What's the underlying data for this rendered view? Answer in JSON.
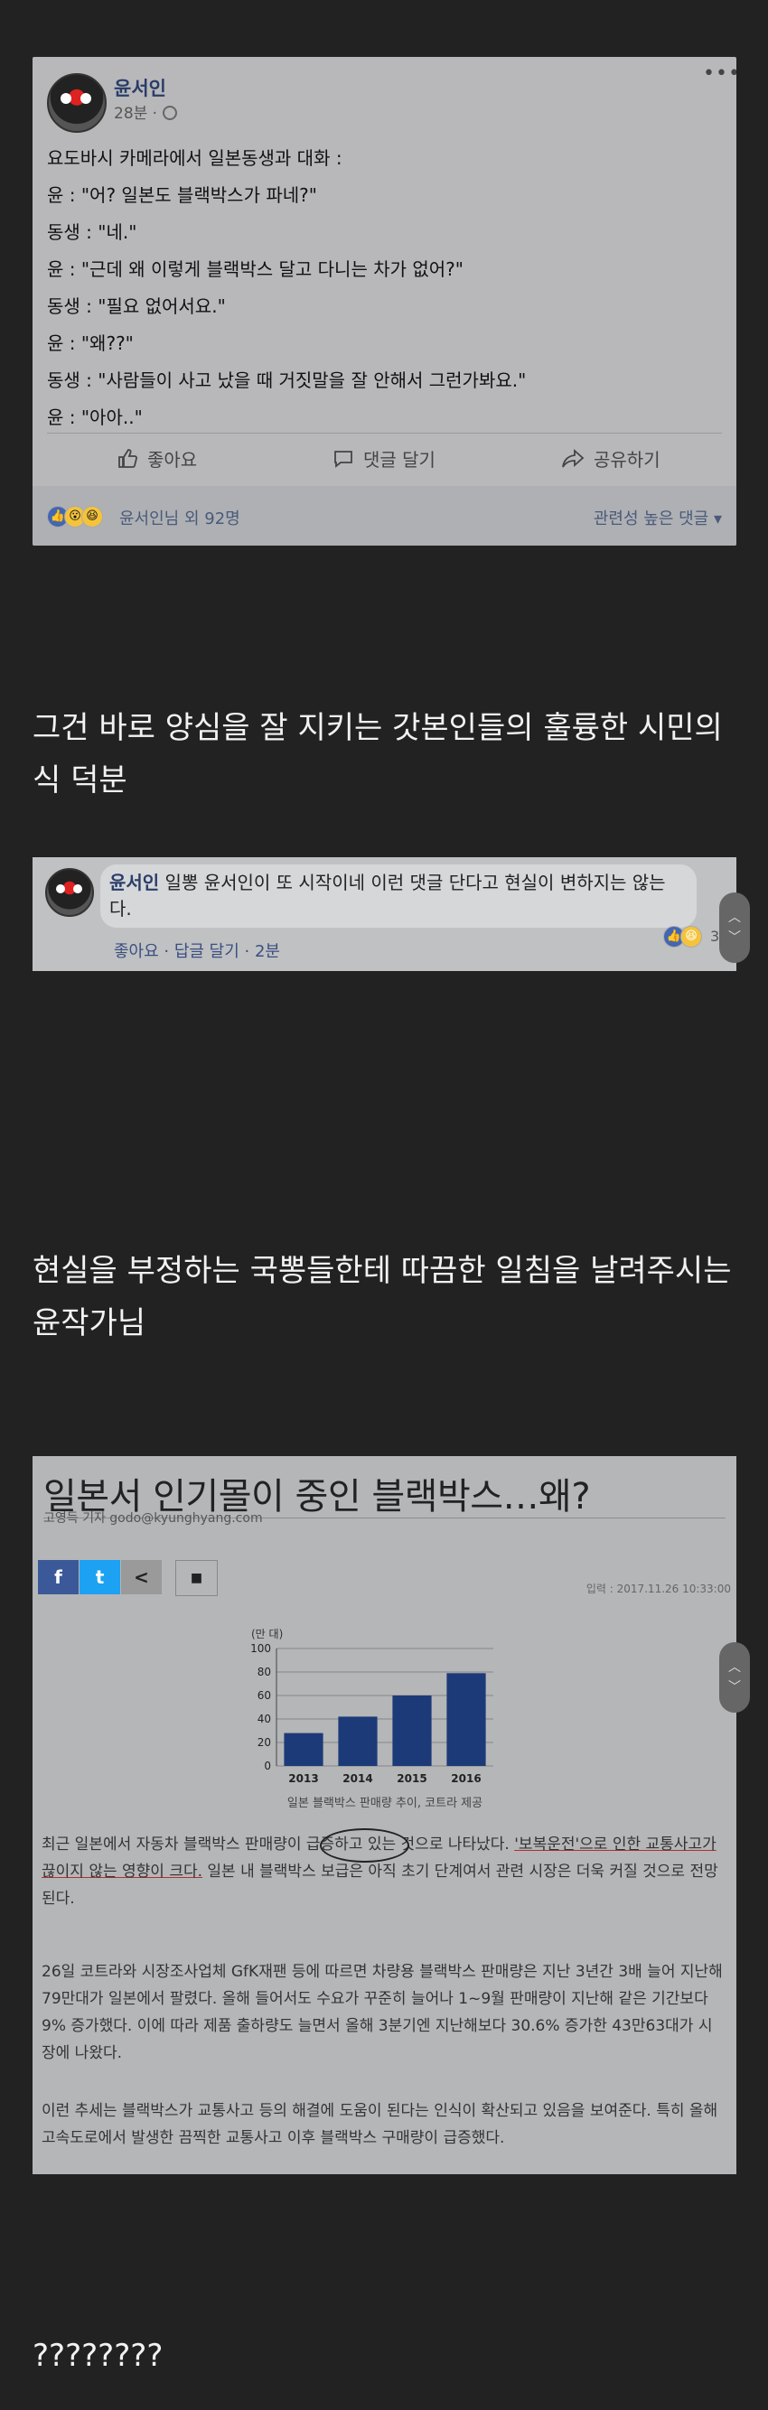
{
  "post": {
    "author": "윤서인",
    "time": "28분 ·",
    "globe_icon": "globe-icon",
    "lines": [
      "요도바시 카메라에서 일본동생과 대화 :",
      "윤 : \"어? 일본도 블랙박스가 파네?\"",
      "동생 : \"네.\"",
      "윤 : \"근데 왜 이렇게 블랙박스 달고 다니는 차가 없어?\"",
      "동생 : \"필요 없어서요.\"",
      "윤 : \"왜??\"",
      "동생 : \"사람들이 사고 났을 때 거짓말을 잘 안해서 그런가봐요.\"",
      "윤 : \"아아..\""
    ],
    "actions": {
      "like": "좋아요",
      "comment": "댓글 달기",
      "share": "공유하기"
    },
    "reactions_text": "윤서인님 외 92명",
    "sort_label": "관련성 높은 댓글 ▾"
  },
  "caption1": "그건 바로 양심을 잘 지키는 갓본인들의 훌륭한 시민의식 덕분",
  "comment": {
    "author": "윤서인",
    "text": " 일뽕 윤서인이 또 시작이네 이런 댓글 단다고 현실이 변하지는 않는다.",
    "meta": "좋아요 · 답글 달기 · 2분",
    "reaction_count": "3"
  },
  "caption2": "현실을 부정하는 국뽕들한테 따끔한 일침을 날려주시는 윤작가님",
  "article": {
    "title": "일본서 인기몰이 중인 블랙박스…왜?",
    "byline": "고영득 기자 godo@kyunghyang.com",
    "date": "입력 : 2017.11.26 10:33:00",
    "share_buttons": [
      "f",
      "t",
      "<",
      "■"
    ],
    "chart_caption": "일본 블랙박스 판매량 추이, 코트라 제공",
    "para1_pre": "최근 일본에서 자동차 블랙박스 판매량이 급증하고 있는 것으로 나타났다. ",
    "para1_underlined": "'보복운전'으로 인한 교통사고가 끊이지 않는 영향이 크다.",
    "para1_post": " 일본 내 블랙박스 보급은 아직 초기 단계여서 관련 시장은 더욱 커질 것으로 전망된다.",
    "para2": "26일 코트라와 시장조사업체 GfK재팬 등에 따르면 차량용 블랙박스 판매량은 지난 3년간 3배 늘어 지난해 79만대가 일본에서 팔렸다. 올해 들어서도 수요가 꾸준히 늘어나 1~9월 판매량이 지난해 같은 기간보다 9% 증가했다. 이에 따라 제품 출하량도 늘면서 올해 3분기엔 지난해보다 30.6% 증가한 43만63대가 시장에 나왔다.",
    "para3": "이런 추세는 블랙박스가 교통사고 등의 해결에 도움이 된다는 인식이 확산되고 있음을 보여준다. 특히 올해 고속도로에서 발생한 끔찍한 교통사고 이후 블랙박스 구매량이 급증했다."
  },
  "chart_data": {
    "type": "bar",
    "title": "",
    "ylabel": "(만 대)",
    "xlabel": "",
    "categories": [
      "2013",
      "2014",
      "2015",
      "2016"
    ],
    "values": [
      28,
      42,
      60,
      79
    ],
    "ylim": [
      0,
      100
    ],
    "yticks": [
      "0",
      "20",
      "40",
      "60",
      "80",
      "100"
    ],
    "grid": true,
    "color": "#1c3a78"
  },
  "caption3": "????????",
  "colors": {
    "page_bg": "#222222",
    "facebook_blue": "#3b5998",
    "twitter_blue": "#1da1f2"
  }
}
